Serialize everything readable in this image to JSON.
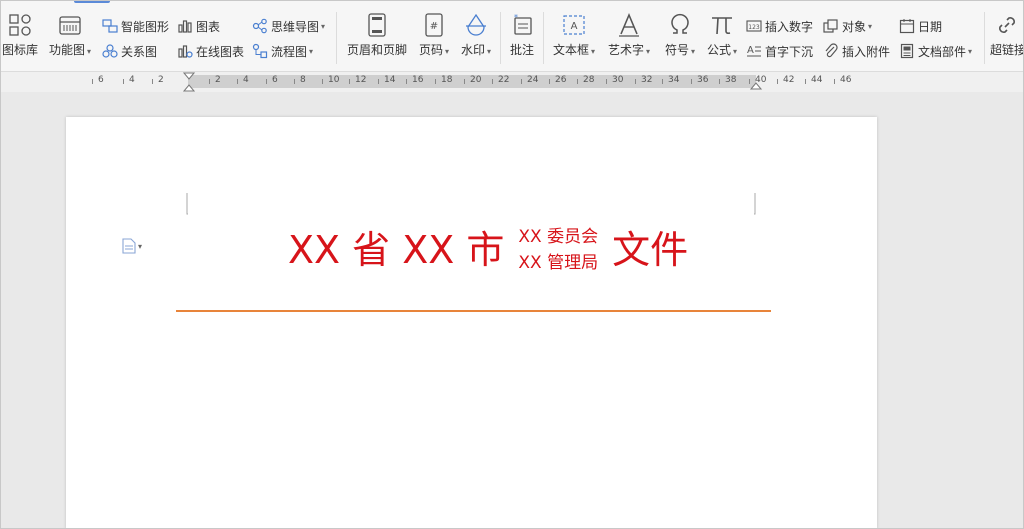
{
  "toolbar": {
    "big_buttons": [
      {
        "label": "图标库",
        "icon": "icon-library-icon"
      },
      {
        "label": "功能图",
        "icon": "function-chart-icon"
      },
      {
        "label": "页眉和页脚",
        "icon": "header-footer-icon"
      },
      {
        "label": "页码",
        "icon": "page-number-icon"
      },
      {
        "label": "水印",
        "icon": "watermark-icon"
      },
      {
        "label": "批注",
        "icon": "comment-icon"
      },
      {
        "label": "文本框",
        "icon": "text-box-icon"
      },
      {
        "label": "艺术字",
        "icon": "word-art-icon"
      },
      {
        "label": "符号",
        "icon": "omega-symbol-icon"
      },
      {
        "label": "公式",
        "icon": "pi-formula-icon"
      },
      {
        "label": "超链接",
        "icon": "hyperlink-icon"
      }
    ],
    "small_buttons": [
      {
        "label": "智能图形",
        "icon": "smart-art-icon"
      },
      {
        "label": "关系图",
        "icon": "relation-chart-icon"
      },
      {
        "label": "图表",
        "icon": "chart-icon"
      },
      {
        "label": "在线图表",
        "icon": "online-chart-icon"
      },
      {
        "label": "思维导图",
        "icon": "mind-map-icon"
      },
      {
        "label": "流程图",
        "icon": "flow-chart-icon"
      },
      {
        "label": "插入数字",
        "icon": "insert-number-icon"
      },
      {
        "label": "首字下沉",
        "icon": "drop-cap-icon"
      },
      {
        "label": "对象",
        "icon": "object-icon"
      },
      {
        "label": "插入附件",
        "icon": "attachment-icon"
      },
      {
        "label": "日期",
        "icon": "date-icon"
      },
      {
        "label": "文档部件",
        "icon": "document-parts-icon"
      }
    ]
  },
  "ruler": {
    "labels": [
      "6",
      "4",
      "2",
      "2",
      "4",
      "6",
      "8",
      "10",
      "12",
      "14",
      "16",
      "18",
      "20",
      "22",
      "24",
      "26",
      "28",
      "30",
      "32",
      "34",
      "36",
      "38",
      "40",
      "42",
      "44",
      "46"
    ]
  },
  "document": {
    "title_part1": "XX 省 XX 市",
    "title_line1": "XX 委员会",
    "title_line2": "XX 管理局",
    "title_part2": "文件",
    "title_color": "#d7141a",
    "line_color": "#e8843a"
  }
}
